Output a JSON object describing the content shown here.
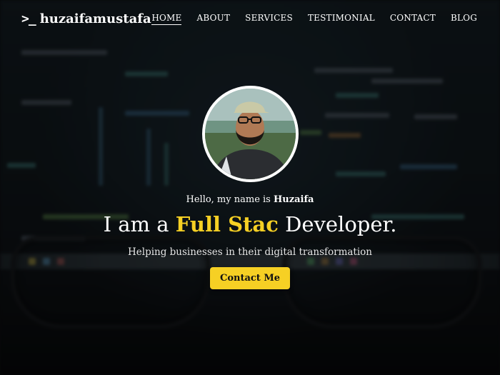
{
  "brand": {
    "prompt": ">_",
    "name": "huzaifamustafa"
  },
  "nav": {
    "items": [
      {
        "label": "HOME",
        "active": true
      },
      {
        "label": "ABOUT",
        "active": false
      },
      {
        "label": "SERVICES",
        "active": false
      },
      {
        "label": "TESTIMONIAL",
        "active": false
      },
      {
        "label": "CONTACT",
        "active": false
      },
      {
        "label": "BLOG",
        "active": false
      }
    ]
  },
  "hero": {
    "greeting_prefix": "Hello, my name is ",
    "greeting_name": "Huzaifa",
    "headline_prefix": "I am a ",
    "headline_highlight": "Full Stac",
    "headline_suffix": " Developer.",
    "subtitle": "Helping businesses in their digital transformation",
    "cta_label": "Contact Me"
  },
  "colors": {
    "accent": "#f6d024",
    "text": "#ffffff",
    "background": "#0b0d0f"
  }
}
